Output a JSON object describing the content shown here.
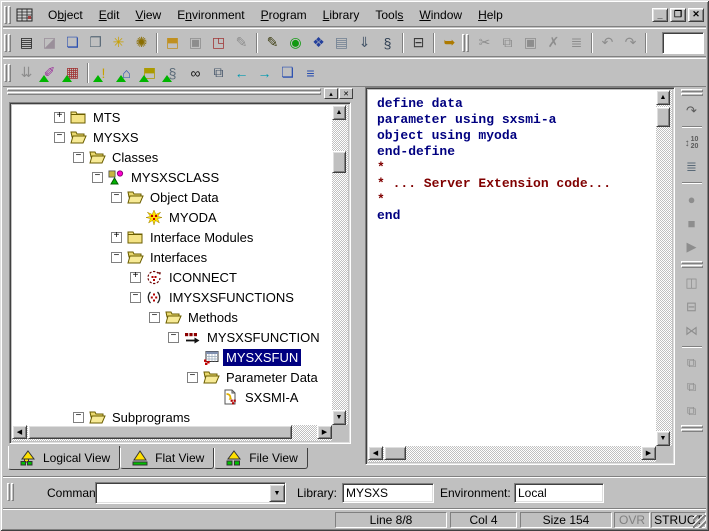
{
  "colors": {
    "base": "#c0c0c0",
    "selection_bg": "#000080",
    "selection_fg": "#ffffff",
    "keyword": "#000080",
    "comment": "#800000",
    "disabled": "#8d8d8d"
  },
  "window": {
    "controls": [
      {
        "name": "minimize",
        "glyph": "_"
      },
      {
        "name": "restore",
        "glyph": "❐"
      },
      {
        "name": "close",
        "glyph": "✕"
      }
    ]
  },
  "menu": {
    "items": [
      {
        "label": "Object",
        "ul": 1
      },
      {
        "label": "Edit",
        "ul": 0
      },
      {
        "label": "View",
        "ul": 0
      },
      {
        "label": "Environment",
        "ul": 1
      },
      {
        "label": "Program",
        "ul": 0
      },
      {
        "label": "Library",
        "ul": 0
      },
      {
        "label": "Tools",
        "ul": 4
      },
      {
        "label": "Window",
        "ul": 0
      },
      {
        "label": "Help",
        "ul": 0
      }
    ]
  },
  "toolbar_main": {
    "items": [
      {
        "type": "grip"
      },
      {
        "name": "object-list-button",
        "glyph": "▤",
        "color": "#1a1a1a"
      },
      {
        "name": "session-button",
        "glyph": "◪",
        "color": "#9a8f9a"
      },
      {
        "name": "new-window-button",
        "glyph": "❏",
        "color": "#2a4fb0"
      },
      {
        "name": "window-list-button",
        "glyph": "❐",
        "color": "#5a6a78"
      },
      {
        "name": "import-button",
        "glyph": "✳",
        "color": "#c8a000"
      },
      {
        "name": "find-object-button",
        "glyph": "✺",
        "color": "#8a6d00"
      },
      {
        "type": "sep"
      },
      {
        "name": "open-button",
        "glyph": "⬒",
        "color": "#c09020"
      },
      {
        "name": "save-button",
        "glyph": "▣",
        "color": "#8d8d8d",
        "disabled": true
      },
      {
        "name": "close-object-button",
        "glyph": "◳",
        "color": "#a03636"
      },
      {
        "name": "edit-object-button",
        "glyph": "✎",
        "color": "#8d8d8d",
        "disabled": true
      },
      {
        "type": "sep"
      },
      {
        "name": "new-source-button",
        "glyph": "✎",
        "color": "#3c3c10"
      },
      {
        "name": "check-button",
        "glyph": "◉",
        "color": "#119a11"
      },
      {
        "name": "stow-button",
        "glyph": "❖",
        "color": "#24409c"
      },
      {
        "name": "list-source-button",
        "glyph": "▤",
        "color": "#6e7e90"
      },
      {
        "name": "sort-button",
        "glyph": "⇓",
        "color": "#46566a"
      },
      {
        "name": "catalog-button",
        "glyph": "§",
        "color": "#2e3e52"
      },
      {
        "type": "sep"
      },
      {
        "name": "print-button",
        "glyph": "⊟",
        "color": "#3a3a3a"
      },
      {
        "type": "sep"
      },
      {
        "name": "exit-button",
        "glyph": "➥",
        "color": "#ad7a00"
      },
      {
        "type": "grip"
      },
      {
        "name": "cut-button",
        "glyph": "✂",
        "color": "#8d8d8d",
        "disabled": true
      },
      {
        "name": "copy-button",
        "glyph": "⧉",
        "color": "#8d8d8d",
        "disabled": true
      },
      {
        "name": "paste-button",
        "glyph": "▣",
        "color": "#8d8d8d",
        "disabled": true
      },
      {
        "name": "delete-button",
        "glyph": "✗",
        "color": "#8d8d8d",
        "disabled": true
      },
      {
        "name": "select-button",
        "glyph": "≣",
        "color": "#8d8d8d",
        "disabled": true
      },
      {
        "type": "sep"
      },
      {
        "name": "undo-button",
        "glyph": "↶",
        "color": "#8d8d8d",
        "disabled": true
      },
      {
        "name": "redo-button",
        "glyph": "↷",
        "color": "#8d8d8d",
        "disabled": true
      },
      {
        "type": "sep"
      }
    ]
  },
  "toolbar_second": {
    "items": [
      {
        "type": "grip"
      },
      {
        "name": "sort-disabled-button",
        "glyph": "⇊",
        "color": "#8d8d8d",
        "disabled": true
      },
      {
        "name": "edit-item-button",
        "glyph": "✐",
        "color": "#9a309a",
        "tri": true
      },
      {
        "name": "list-item-button",
        "glyph": "▦",
        "color": "#a03030",
        "tri": true
      },
      {
        "type": "sep"
      },
      {
        "name": "check-item-button",
        "glyph": "!",
        "color": "#c8a000",
        "tri": true
      },
      {
        "name": "home-item-button",
        "glyph": "⌂",
        "color": "#2a4fb0",
        "tri": true
      },
      {
        "name": "open-item-button",
        "glyph": "⬒",
        "color": "#ab9a00",
        "tri": true
      },
      {
        "name": "stow-item-button",
        "glyph": "§",
        "color": "#5a6a78",
        "tri": true
      },
      {
        "name": "find-button",
        "glyph": "∞",
        "color": "#1a1a1a"
      },
      {
        "name": "copy-history-button",
        "glyph": "⧉",
        "color": "#46566a"
      },
      {
        "name": "navigate-back-button",
        "glyph": "←",
        "color": "#009ab0"
      },
      {
        "name": "navigate-forward-button",
        "glyph": "→",
        "color": "#009ab0"
      },
      {
        "name": "cascade-button",
        "glyph": "❏",
        "color": "#2a4fb0"
      },
      {
        "name": "tile-button",
        "glyph": "≡",
        "color": "#2a4fb0"
      }
    ]
  },
  "toolbar_right": {
    "items": [
      {
        "type": "grip"
      },
      {
        "name": "update-source-button",
        "glyph": "↷",
        "color": "#5a5a5a"
      },
      {
        "type": "sep"
      },
      {
        "name": "renumber-button",
        "glyph": "↕",
        "lines": [
          "10",
          "20"
        ],
        "color": "#5a5a5a"
      },
      {
        "name": "shift-source-button",
        "glyph": "≣",
        "color": "#5a6a78"
      },
      {
        "type": "sep"
      },
      {
        "name": "record-button",
        "glyph": "●",
        "color": "#8d8d8d",
        "disabled": true
      },
      {
        "name": "stop-button",
        "glyph": "■",
        "color": "#8d8d8d",
        "disabled": true
      },
      {
        "name": "run-button",
        "glyph": "▶",
        "color": "#8d8d8d",
        "disabled": true
      },
      {
        "type": "grip"
      },
      {
        "name": "tile-vertical-button",
        "glyph": "◫",
        "color": "#8d8d8d",
        "disabled": true
      },
      {
        "name": "tile-horizontal-button",
        "glyph": "⊟",
        "color": "#8d8d8d",
        "disabled": true
      },
      {
        "name": "fit-window-button",
        "glyph": "⋈",
        "color": "#8d8d8d",
        "disabled": true
      },
      {
        "type": "sep"
      },
      {
        "name": "new-edit-window-button",
        "glyph": "⧉",
        "color": "#8d8d8d",
        "disabled": true
      },
      {
        "name": "add-edit-window-button",
        "glyph": "⧉",
        "color": "#8d8d8d",
        "disabled": true
      },
      {
        "name": "close-edit-window-button",
        "glyph": "⧉",
        "color": "#8d8d8d",
        "disabled": true
      },
      {
        "type": "grip"
      }
    ]
  },
  "left_panel": {
    "dock_buttons": [
      {
        "name": "collapse",
        "glyph": "▴"
      },
      {
        "name": "close",
        "glyph": "✕"
      }
    ]
  },
  "tree": {
    "items": [
      {
        "label": "MTS",
        "depth": 2,
        "expand": "+",
        "icon": "folder-closed"
      },
      {
        "label": "MYSXS",
        "depth": 2,
        "expand": "-",
        "icon": "folder-open"
      },
      {
        "label": "Classes",
        "depth": 3,
        "expand": "-",
        "icon": "folder-open"
      },
      {
        "label": "MYSXSCLASS",
        "depth": 4,
        "expand": "-",
        "icon": "class"
      },
      {
        "label": "Object Data",
        "depth": 5,
        "expand": "-",
        "icon": "folder-open"
      },
      {
        "label": "MYODA",
        "depth": 6,
        "expand": null,
        "icon": "oda"
      },
      {
        "label": "Interface Modules",
        "depth": 5,
        "expand": "+",
        "icon": "folder-closed"
      },
      {
        "label": "Interfaces",
        "depth": 5,
        "expand": "-",
        "icon": "folder-open"
      },
      {
        "label": "ICONNECT",
        "depth": 6,
        "expand": "+",
        "icon": "iface1"
      },
      {
        "label": "IMYSXSFUNCTIONS",
        "depth": 6,
        "expand": "-",
        "icon": "iface2"
      },
      {
        "label": "Methods",
        "depth": 7,
        "expand": "-",
        "icon": "folder-open"
      },
      {
        "label": "MYSXSFUNCTION",
        "depth": 8,
        "expand": "-",
        "icon": "method"
      },
      {
        "label": "MYSXSFUN",
        "depth": 9,
        "expand": null,
        "icon": "function",
        "selected": true
      },
      {
        "label": "Parameter Data",
        "depth": 9,
        "expand": "-",
        "icon": "folder-open"
      },
      {
        "label": "SXSMI-A",
        "depth": 10,
        "expand": null,
        "icon": "sxsmi"
      },
      {
        "label": "Subprograms",
        "depth": 3,
        "expand": "-",
        "icon": "folder-open"
      }
    ]
  },
  "tabs": [
    {
      "label": "Logical View",
      "icon": "lamp-logical",
      "active": true
    },
    {
      "label": "Flat View",
      "icon": "lamp-flat",
      "active": false
    },
    {
      "label": "File View",
      "icon": "lamp-file",
      "active": false
    }
  ],
  "editor": {
    "lines": [
      {
        "text": "define data",
        "type": "keyword"
      },
      {
        "text": "parameter using sxsmi-a",
        "type": "keyword"
      },
      {
        "text": "object using myoda",
        "type": "keyword"
      },
      {
        "text": "end-define",
        "type": "keyword"
      },
      {
        "text": "*",
        "type": "comment"
      },
      {
        "text": "* ... Server Extension code...",
        "type": "comment"
      },
      {
        "text": "*",
        "type": "comment"
      },
      {
        "text": "end",
        "type": "keyword"
      }
    ]
  },
  "command_bar": {
    "command_label": "Command:",
    "command_value": "",
    "dropdown_glyph": "▼",
    "library_label": "Library:",
    "library_value": "MYSXS",
    "environment_label": "Environment:",
    "environment_value": "Local"
  },
  "status_bar": {
    "panels": [
      {
        "label": "Line 8/8"
      },
      {
        "label": "Col 4"
      },
      {
        "label": "Size 154"
      },
      {
        "label": "OVR",
        "disabled": true
      },
      {
        "label": "STRUCT"
      }
    ]
  }
}
